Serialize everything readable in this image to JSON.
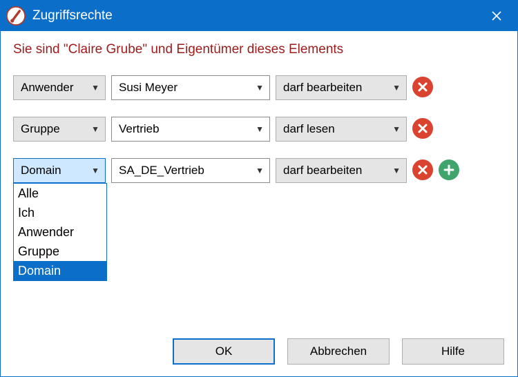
{
  "titlebar": {
    "title": "Zugriffsrechte"
  },
  "headline": "Sie sind \"Claire Grube\" und Eigentümer dieses Elements",
  "rows": [
    {
      "type": "Anwender",
      "name": "Susi Meyer",
      "perm": "darf bearbeiten"
    },
    {
      "type": "Gruppe",
      "name": "Vertrieb",
      "perm": "darf lesen"
    },
    {
      "type": "Domain",
      "name": "SA_DE_Vertrieb",
      "perm": "darf bearbeiten"
    }
  ],
  "type_dropdown": {
    "open_on_row": 2,
    "options": [
      "Alle",
      "Ich",
      "Anwender",
      "Gruppe",
      "Domain"
    ],
    "selected": "Domain"
  },
  "buttons": {
    "ok": "OK",
    "cancel": "Abbrechen",
    "help": "Hilfe"
  }
}
